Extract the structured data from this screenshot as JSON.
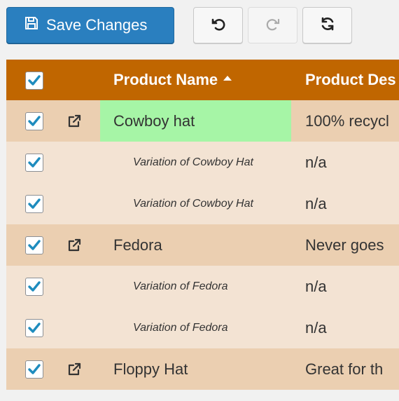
{
  "toolbar": {
    "save_label": "Save Changes",
    "undo_icon": "undo-icon",
    "redo_icon": "redo-icon",
    "refresh_icon": "refresh-icon"
  },
  "colors": {
    "header_bg": "#c06600",
    "parent_row_bg": "#ebcfb1",
    "child_row_bg": "#f3e3d3",
    "edited_cell_bg": "#a6f5a6",
    "primary_button": "#2a7fbf",
    "checkbox_check": "#1e8cbe"
  },
  "table": {
    "columns": [
      "Product Name",
      "Product Des"
    ],
    "sort": {
      "column": "Product Name",
      "direction": "ascending"
    },
    "rows": [
      {
        "type": "parent",
        "checked": true,
        "name": "Cowboy hat",
        "desc": "100% recycl",
        "edited": true
      },
      {
        "type": "child",
        "checked": true,
        "name": "Variation of Cowboy Hat",
        "desc": "n/a"
      },
      {
        "type": "child",
        "checked": true,
        "name": "Variation of Cowboy Hat",
        "desc": "n/a"
      },
      {
        "type": "parent",
        "checked": true,
        "name": "Fedora",
        "desc": "Never goes"
      },
      {
        "type": "child",
        "checked": true,
        "name": "Variation of Fedora",
        "desc": "n/a"
      },
      {
        "type": "child",
        "checked": true,
        "name": "Variation of Fedora",
        "desc": "n/a"
      },
      {
        "type": "parent",
        "checked": true,
        "name": "Floppy Hat",
        "desc": "Great for th"
      }
    ]
  }
}
